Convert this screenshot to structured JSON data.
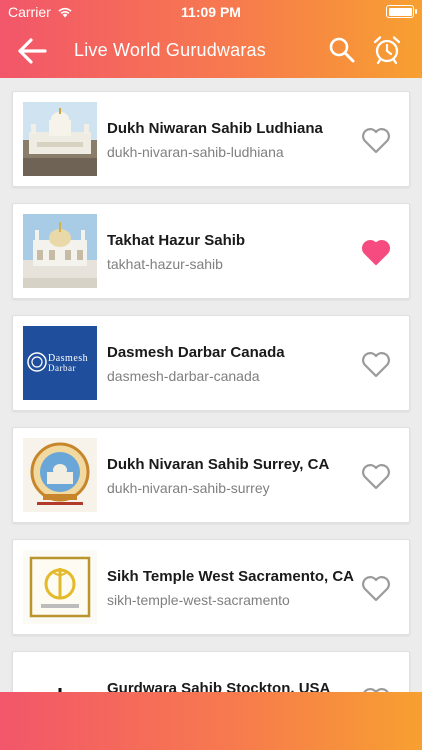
{
  "status_bar": {
    "carrier": "Carrier",
    "time": "11:09 PM"
  },
  "header": {
    "title": "Live World Gurudwaras",
    "back_icon": "arrow-left-icon",
    "search_icon": "search-icon",
    "alarm_icon": "alarm-clock-icon"
  },
  "items": [
    {
      "name": "Dukh Niwaran Sahib Ludhiana",
      "slug": "dukh-nivaran-sahib-ludhiana",
      "favorite": false
    },
    {
      "name": "Takhat Hazur Sahib",
      "slug": "takhat-hazur-sahib",
      "favorite": true
    },
    {
      "name": "Dasmesh Darbar Canada",
      "slug": "dasmesh-darbar-canada",
      "favorite": false,
      "logo_text": "Dasmesh Darbar"
    },
    {
      "name": "Dukh Nivaran Sahib Surrey, CA",
      "slug": "dukh-nivaran-sahib-surrey",
      "favorite": false
    },
    {
      "name": "Sikh Temple West Sacramento, CA",
      "slug": "sikh-temple-west-sacramento",
      "favorite": false
    },
    {
      "name": "Gurdwara Sahib Stockton, USA",
      "slug": "",
      "favorite": false
    }
  ],
  "colors": {
    "header_gradient_start": "#f2566a",
    "header_gradient_end": "#f7a030",
    "favorite_active": "#f54b80",
    "favorite_inactive": "#9a9a9a"
  }
}
